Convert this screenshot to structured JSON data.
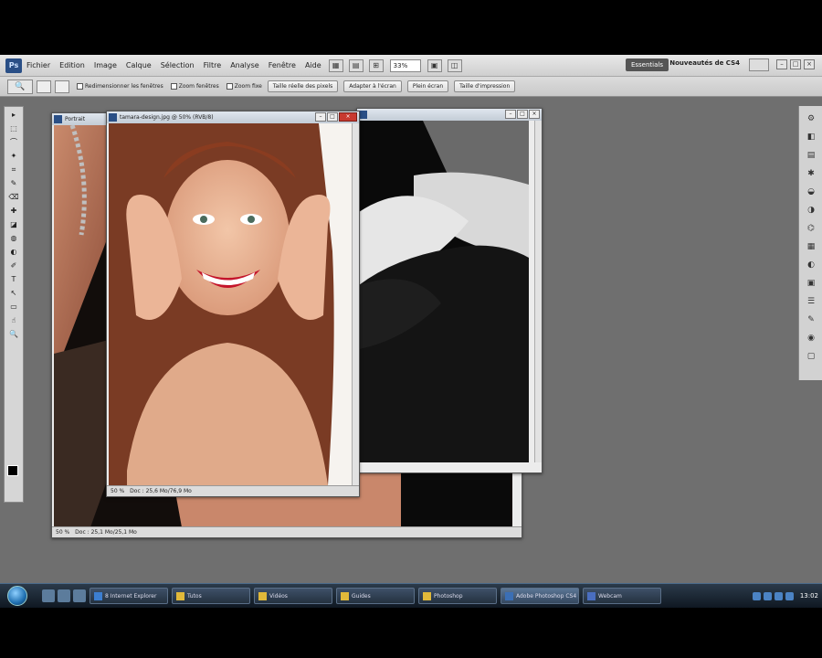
{
  "menubar": {
    "logo": "Ps",
    "items": [
      "Fichier",
      "Edition",
      "Image",
      "Calque",
      "Sélection",
      "Filtre",
      "Analyse",
      "Fenêtre",
      "Aide"
    ],
    "zoom": "33%",
    "workspace_button": "Essentials",
    "brand": "Nouveautés de CS4",
    "window_controls": [
      "–",
      "□",
      "×"
    ]
  },
  "optbar": {
    "tool_icon": "zoom-icon",
    "checks": [
      "Redimensionner les fenêtres",
      "Zoom fenêtres",
      "Zoom fixe"
    ],
    "buttons": [
      "Taille réelle des pixels",
      "Adapter à l'écran",
      "Plein écran",
      "Taille d'impression"
    ]
  },
  "toolbox": {
    "tools": [
      "▸",
      "⬚",
      "⌒",
      "✦",
      "⌗",
      "✎",
      "⌫",
      "✚",
      "◪",
      "◍",
      "◐",
      "✐",
      "T",
      "↖",
      "▭",
      "☝",
      "🔍"
    ]
  },
  "panels": [
    "⚙",
    "◧",
    "▤",
    "✱",
    "◒",
    "◑",
    "⌬",
    "▦",
    "◐",
    "▣",
    "☰",
    "✎",
    "◉",
    "▢"
  ],
  "windows": {
    "winA": {
      "title": "Portrait",
      "status_zoom": "50 %",
      "status_doc": "Doc : 25,1 Mo/25,1 Mo"
    },
    "winB": {
      "title": ""
    },
    "winC": {
      "title": "tamara-design.jpg @ 50% (RVB/8)",
      "status_zoom": "50 %",
      "status_doc": "Doc : 25,6 Mo/76,9 Mo"
    }
  },
  "taskbar": {
    "tasks": [
      {
        "label": "8 Internet Explorer",
        "color": "#3c7ed0",
        "active": false
      },
      {
        "label": "Tutos",
        "color": "#e1b93a",
        "active": false
      },
      {
        "label": "Vidéos",
        "color": "#e1b93a",
        "active": false
      },
      {
        "label": "Guides",
        "color": "#e1b93a",
        "active": false
      },
      {
        "label": "Photoshop",
        "color": "#e1b93a",
        "active": false
      },
      {
        "label": "Adobe Photoshop CS4",
        "color": "#3b6fb5",
        "active": true
      },
      {
        "label": "Webcam",
        "color": "#4a6ec0",
        "active": false
      }
    ],
    "clock": "13:02"
  }
}
